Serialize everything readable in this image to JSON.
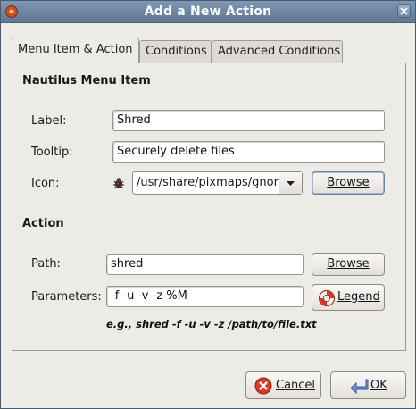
{
  "window": {
    "title": "Add a New Action"
  },
  "tabs": [
    {
      "label": "Menu Item & Action"
    },
    {
      "label": "Conditions"
    },
    {
      "label": "Advanced Conditions"
    }
  ],
  "menu_item": {
    "section_title": "Nautilus Menu Item",
    "label_label": "Label:",
    "label_value": "Shred",
    "tooltip_label": "Tooltip:",
    "tooltip_value": "Securely delete files",
    "icon_label": "Icon:",
    "icon_value": "/usr/share/pixmaps/gnor",
    "browse_label": "Browse"
  },
  "action": {
    "section_title": "Action",
    "path_label": "Path:",
    "path_value": "shred",
    "browse_label": "Browse",
    "params_label": "Parameters:",
    "params_value": "-f -u -v -z %M",
    "legend_label": "Legend",
    "hint": "e.g., shred -f -u -v -z /path/to/file.txt"
  },
  "dialog": {
    "cancel_label": "Cancel",
    "ok_label": "OK"
  },
  "colors": {
    "titlebar": "#6f87a4",
    "cancel_icon": "#d63a2a",
    "ok_icon": "#4a7cc2"
  }
}
